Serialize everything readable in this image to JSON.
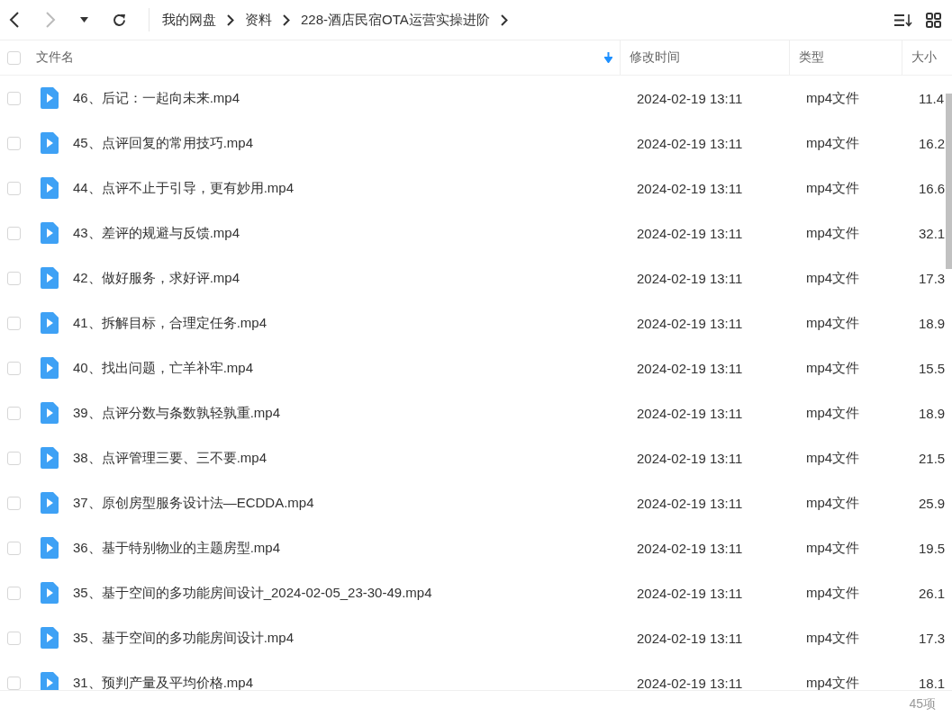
{
  "breadcrumb": [
    "我的网盘",
    "资料",
    "228-酒店民宿OTA运营实操进阶"
  ],
  "columns": [
    {
      "label": "文件名",
      "sorted": true
    },
    {
      "label": "修改时间",
      "sorted": false
    },
    {
      "label": "类型",
      "sorted": false
    },
    {
      "label": "大小",
      "sorted": false
    }
  ],
  "header_checked": false,
  "rows": [
    {
      "name": "46、后记：一起向未来.mp4",
      "modified": "2024-02-19 13:11",
      "type": "mp4文件",
      "size": "11.4",
      "checked": false
    },
    {
      "name": "45、点评回复的常用技巧.mp4",
      "modified": "2024-02-19 13:11",
      "type": "mp4文件",
      "size": "16.2",
      "checked": false
    },
    {
      "name": "44、点评不止于引导，更有妙用.mp4",
      "modified": "2024-02-19 13:11",
      "type": "mp4文件",
      "size": "16.6",
      "checked": false
    },
    {
      "name": "43、差评的规避与反馈.mp4",
      "modified": "2024-02-19 13:11",
      "type": "mp4文件",
      "size": "32.1",
      "checked": false
    },
    {
      "name": "42、做好服务，求好评.mp4",
      "modified": "2024-02-19 13:11",
      "type": "mp4文件",
      "size": "17.3",
      "checked": false
    },
    {
      "name": "41、拆解目标，合理定任务.mp4",
      "modified": "2024-02-19 13:11",
      "type": "mp4文件",
      "size": "18.9",
      "checked": false
    },
    {
      "name": "40、找出问题，亡羊补牢.mp4",
      "modified": "2024-02-19 13:11",
      "type": "mp4文件",
      "size": "15.5",
      "checked": false
    },
    {
      "name": "39、点评分数与条数孰轻孰重.mp4",
      "modified": "2024-02-19 13:11",
      "type": "mp4文件",
      "size": "18.9",
      "checked": false
    },
    {
      "name": "38、点评管理三要、三不要.mp4",
      "modified": "2024-02-19 13:11",
      "type": "mp4文件",
      "size": "21.5",
      "checked": false
    },
    {
      "name": "37、原创房型服务设计法—ECDDA.mp4",
      "modified": "2024-02-19 13:11",
      "type": "mp4文件",
      "size": "25.9",
      "checked": false
    },
    {
      "name": "36、基于特别物业的主题房型.mp4",
      "modified": "2024-02-19 13:11",
      "type": "mp4文件",
      "size": "19.5",
      "checked": false
    },
    {
      "name": "35、基于空间的多功能房间设计_2024-02-05_23-30-49.mp4",
      "modified": "2024-02-19 13:11",
      "type": "mp4文件",
      "size": "26.1",
      "checked": false
    },
    {
      "name": "35、基于空间的多功能房间设计.mp4",
      "modified": "2024-02-19 13:11",
      "type": "mp4文件",
      "size": "17.3",
      "checked": false
    },
    {
      "name": "31、预判产量及平均价格.mp4",
      "modified": "2024-02-19 13:11",
      "type": "mp4文件",
      "size": "18.1",
      "checked": false
    }
  ],
  "item_count": "45项"
}
